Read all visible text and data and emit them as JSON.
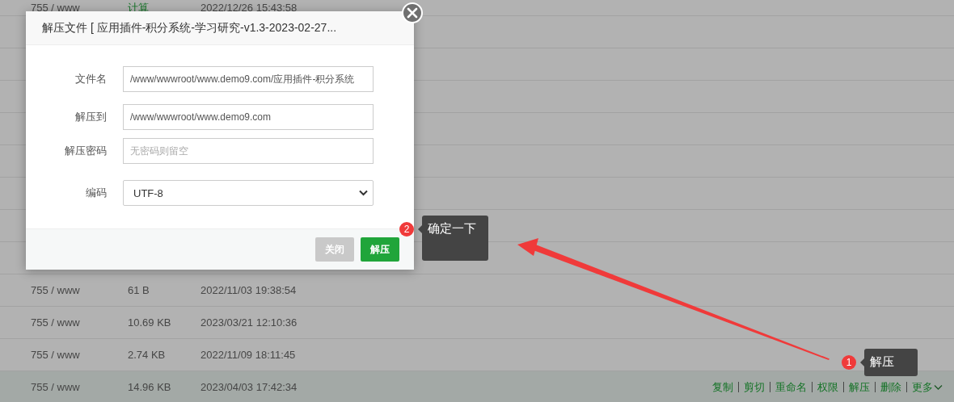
{
  "table": {
    "rows": [
      {
        "permission": "755 / www",
        "size": "计算",
        "size_link": true,
        "modified": "2022/12/26 15:43:58",
        "selected": false
      },
      {
        "selected": false
      },
      {
        "selected": false
      },
      {
        "selected": false
      },
      {
        "selected": false
      },
      {
        "selected": false
      },
      {
        "selected": false
      },
      {
        "selected": false
      },
      {
        "selected": false
      },
      {
        "permission": "755 / www",
        "size": "61 B",
        "size_link": false,
        "modified": "2022/11/03 19:38:54",
        "selected": false
      },
      {
        "permission": "755 / www",
        "size": "10.69 KB",
        "size_link": false,
        "modified": "2023/03/21 12:10:36",
        "selected": false
      },
      {
        "permission": "755 / www",
        "size": "2.74 KB",
        "size_link": false,
        "modified": "2022/11/09 18:11:45",
        "selected": false
      },
      {
        "permission": "755 / www",
        "size": "14.96 KB",
        "size_link": false,
        "modified": "2023/04/03 17:42:34",
        "selected": true,
        "actions": [
          "复制",
          "剪切",
          "重命名",
          "权限",
          "解压",
          "删除",
          "更多"
        ]
      }
    ]
  },
  "dialog": {
    "title": "解压文件 [ 应用插件-积分系统-学习研究-v1.3-2023-02-27...",
    "fields": [
      {
        "label": "文件名",
        "kind": "input",
        "value": "/www/wwwroot/www.demo9.com/应用插件-积分系统"
      },
      {
        "label": "解压到",
        "kind": "input",
        "value": "/www/wwwroot/www.demo9.com"
      },
      {
        "label": "解压密码",
        "kind": "input",
        "placeholder": "无密码则留空"
      },
      {
        "label": "编码",
        "kind": "select",
        "value": "UTF-8"
      }
    ],
    "buttons": [
      {
        "label": "关闭",
        "kind": "secondary"
      },
      {
        "label": "解压",
        "kind": "primary"
      }
    ]
  },
  "annotations": [
    {
      "number": "2",
      "text": "确定一下"
    },
    {
      "number": "1",
      "text": "解压"
    }
  ]
}
